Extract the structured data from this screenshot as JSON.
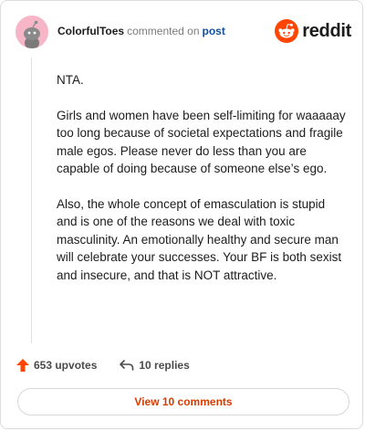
{
  "comment": {
    "author": "ColorfulToes",
    "action": "commented on",
    "target": "post",
    "paragraphs": [
      "NTA.",
      "Girls and women have been self-limiting for waaaaay too long because of societal expectations and fragile male egos. Please never do less than you are capable of doing because of someone else’s ego.",
      "Also, the whole concept of emasculation is stupid and is one of the reasons we deal with toxic masculinity. An emotionally healthy and secure man will celebrate your successes. Your BF is both sexist and insecure, and that is NOT attractive."
    ]
  },
  "brand": {
    "name": "reddit",
    "icon": "reddit-alien-icon",
    "color": "#ff4500"
  },
  "stats": {
    "upvotes": "653 upvotes",
    "replies": "10 replies"
  },
  "view_comments_label": "View 10 comments",
  "colors": {
    "accent": "#d93a00",
    "link": "#0f4f9e",
    "upvote": "#ff4500"
  }
}
